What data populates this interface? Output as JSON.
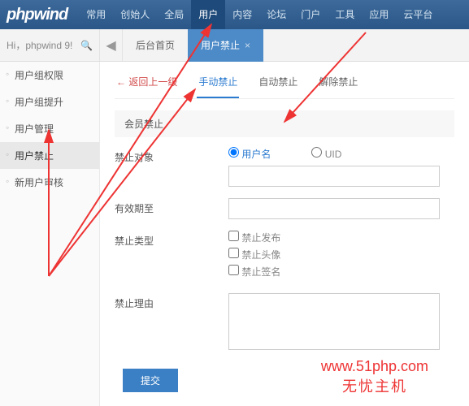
{
  "logo": "phpwind",
  "topnav": [
    "常用",
    "创始人",
    "全局",
    "用户",
    "内容",
    "论坛",
    "门户",
    "工具",
    "应用",
    "云平台"
  ],
  "topnav_active": 3,
  "welcome": "Hi，phpwind 9!",
  "tabs": [
    {
      "label": "后台首页",
      "active": false,
      "closable": false
    },
    {
      "label": "用户禁止",
      "active": true,
      "closable": true
    }
  ],
  "sidebar": {
    "items": [
      "用户组权限",
      "用户组提升",
      "用户管理",
      "用户禁止",
      "新用户审核"
    ],
    "active": 3
  },
  "subtabs": {
    "back": "返回上一级",
    "items": [
      "手动禁止",
      "自动禁止",
      "解除禁止"
    ],
    "active": 0
  },
  "section_title": "会员禁止",
  "form": {
    "target_label": "禁止对象",
    "radio_username": "用户名",
    "radio_uid": "UID",
    "target_value": "",
    "expire_label": "有效期至",
    "expire_value": "",
    "type_label": "禁止类型",
    "type_options": [
      "禁止发布",
      "禁止头像",
      "禁止签名"
    ],
    "reason_label": "禁止理由",
    "reason_value": "",
    "submit": "提交"
  },
  "watermark": {
    "line1": "www.51php.com",
    "line2": "无忧主机"
  }
}
